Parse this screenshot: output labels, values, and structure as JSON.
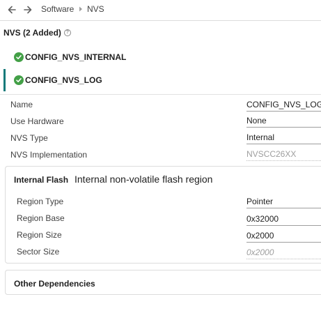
{
  "breadcrumb": {
    "items": [
      "Software",
      "NVS"
    ]
  },
  "section": {
    "title": "NVS (2 Added)",
    "help_glyph": "?"
  },
  "instances": [
    {
      "label": "CONFIG_NVS_INTERNAL",
      "status": "ok",
      "selected": false
    },
    {
      "label": "CONFIG_NVS_LOG",
      "status": "ok",
      "selected": true
    }
  ],
  "fields": {
    "name": {
      "label": "Name",
      "value": "CONFIG_NVS_LOG"
    },
    "use_hardware": {
      "label": "Use Hardware",
      "value": "None"
    },
    "nvs_type": {
      "label": "NVS Type",
      "value": "Internal"
    },
    "nvs_implementation": {
      "label": "NVS Implementation",
      "value": "NVSCC26XX"
    }
  },
  "internal_flash": {
    "title": "Internal Flash",
    "description": "Internal non-volatile flash region",
    "fields": {
      "region_type": {
        "label": "Region Type",
        "value": "Pointer"
      },
      "region_base": {
        "label": "Region Base",
        "value": "0x32000"
      },
      "region_size": {
        "label": "Region Size",
        "value": "0x2000"
      },
      "sector_size": {
        "label": "Sector Size",
        "value": "0x2000"
      }
    }
  },
  "other_dependencies": {
    "title": "Other Dependencies"
  },
  "colors": {
    "accent": "#157a7a",
    "status_ok": "#43a047",
    "divider": "#dcdcdc"
  },
  "icons": {
    "back": "arrow-left-icon",
    "forward": "arrow-right-icon",
    "separator": "chevron-right-icon",
    "status": "check-circle-icon",
    "help": "help-icon"
  }
}
